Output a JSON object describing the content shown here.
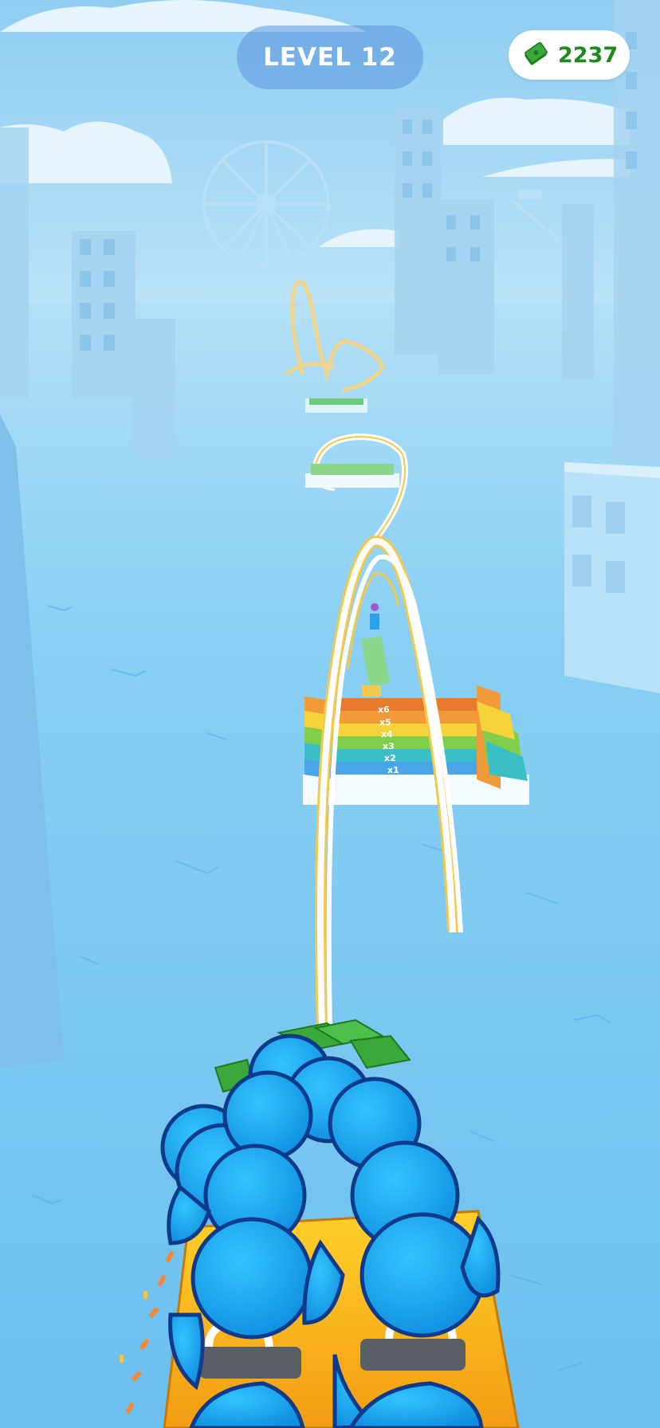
{
  "hud": {
    "level_label": "LEVEL 12",
    "money_amount": "2237",
    "money_icon": "cash-stack-icon"
  },
  "multipliers": [
    "x6",
    "x5",
    "x4",
    "x3",
    "x2",
    "x1"
  ],
  "colors": {
    "sky": "#9fd4f4",
    "water": "#7cc6f0",
    "building": "#a9d8f3",
    "track_rail": "#ffffff",
    "track_edge": "#f2c94c",
    "rider": "#19a8ef",
    "rider_outline": "#0d3a8a",
    "cart": "#f7b818",
    "cash": "#3aa83a",
    "money_text": "#1f8a1f"
  }
}
